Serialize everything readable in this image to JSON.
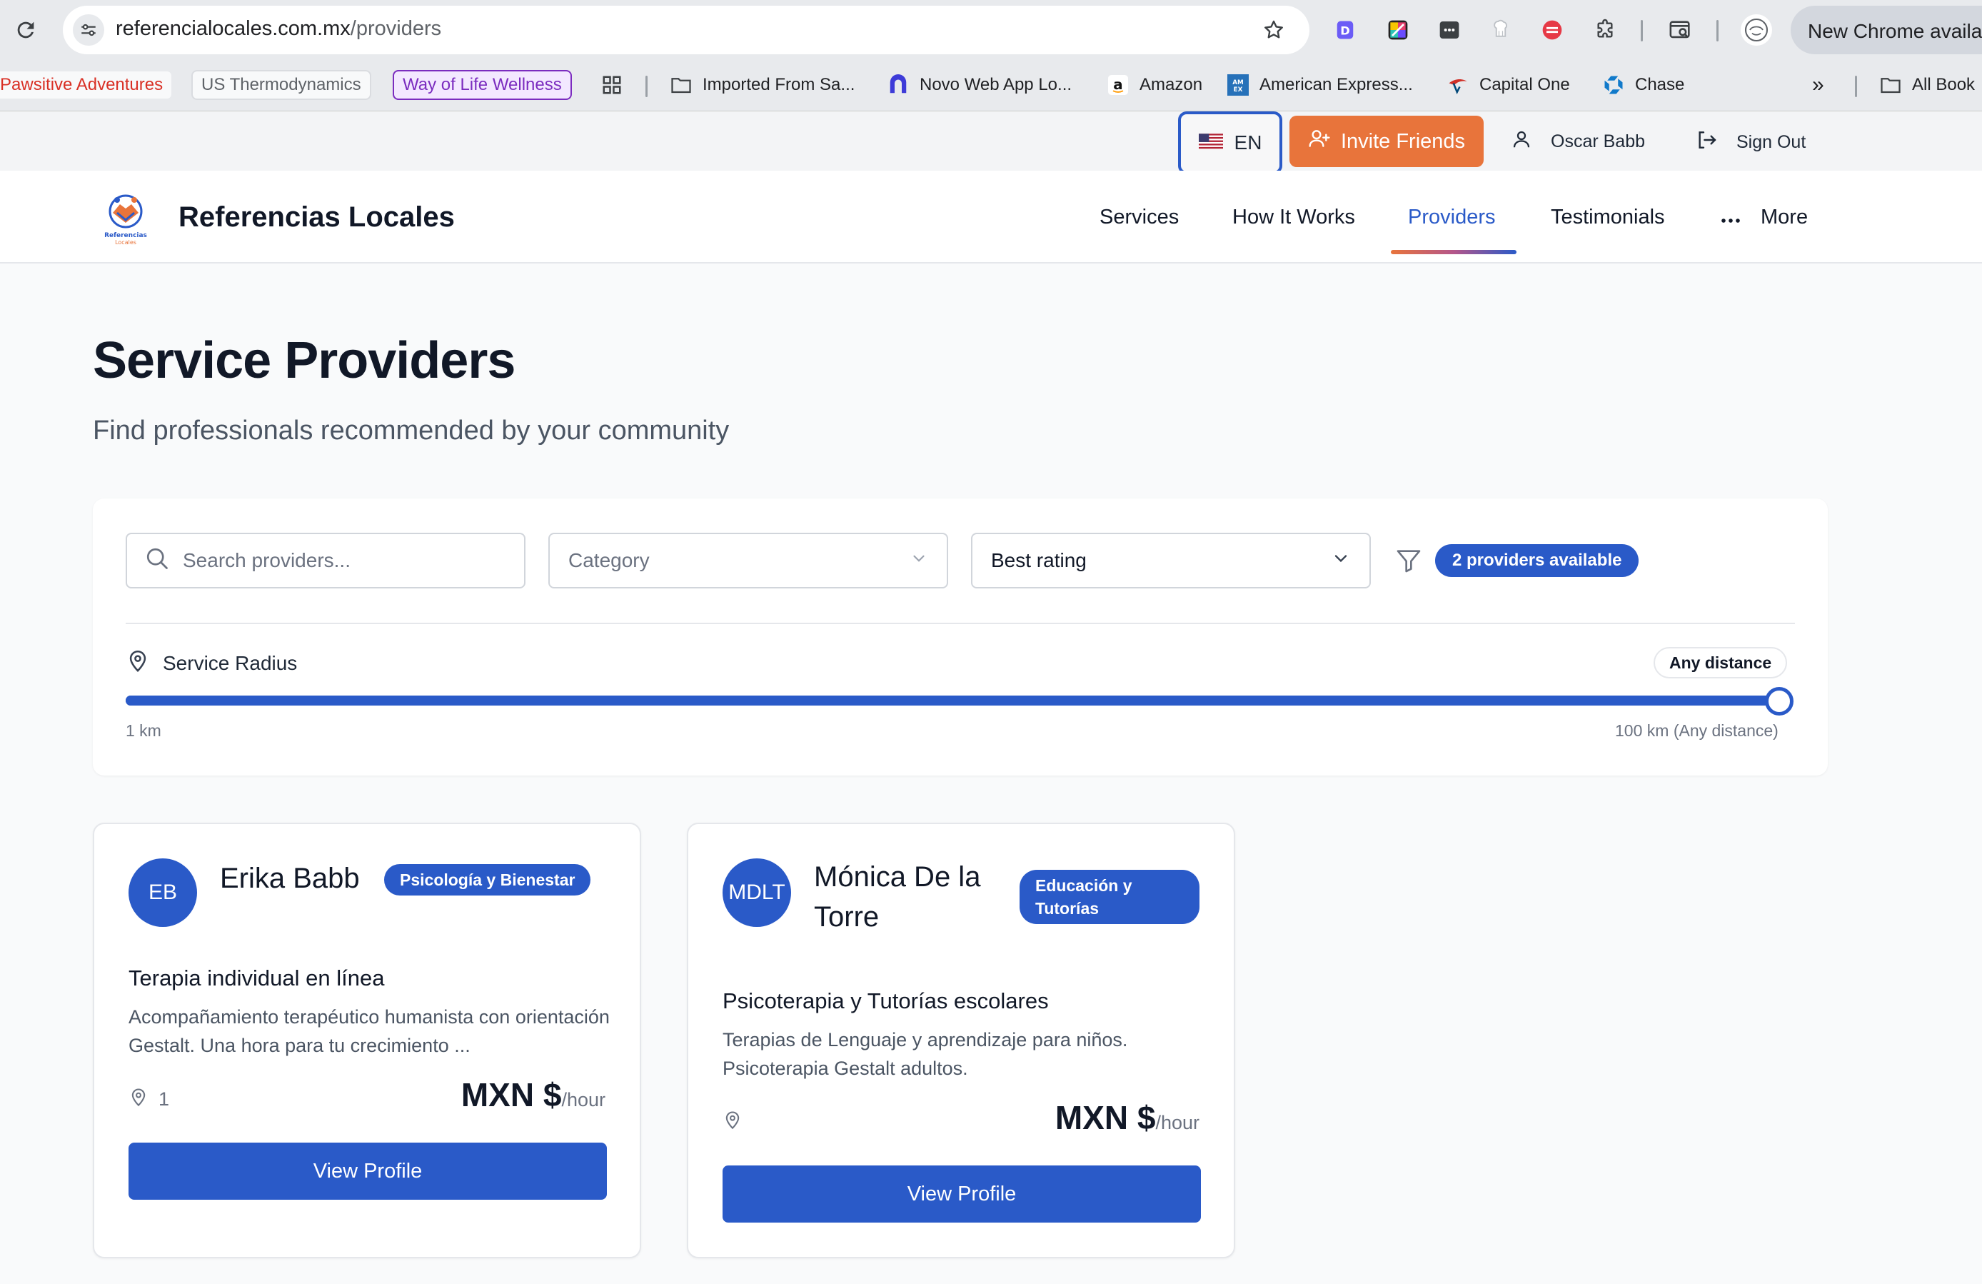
{
  "browser": {
    "url_host": "referencialocales.com.mx",
    "url_path": "/providers",
    "update_label": "New Chrome availab",
    "bookmarks": [
      {
        "label": "Pawsitive Adventures",
        "color": "#d93025"
      },
      {
        "label": "US Thermodynamics",
        "color": "#5f6368"
      },
      {
        "label": "Way of Life Wellness",
        "color": "#7b2cbf"
      },
      {
        "label": "Imported From Sa..."
      },
      {
        "label": "Novo Web App Lo..."
      },
      {
        "label": "Amazon"
      },
      {
        "label": "American Express..."
      },
      {
        "label": "Capital One"
      },
      {
        "label": "Chase"
      },
      {
        "label": "All Book"
      }
    ],
    "overflow_label": "»"
  },
  "topbar": {
    "lang": "EN",
    "invite": "Invite Friends",
    "user": "Oscar Babb",
    "sign_out": "Sign Out"
  },
  "nav": {
    "brand": "Referencias Locales",
    "logo_text_1": "Referencias",
    "logo_text_2": "Locales",
    "items": [
      "Services",
      "How It Works",
      "Providers",
      "Testimonials",
      "More"
    ],
    "active": "Providers"
  },
  "page": {
    "title": "Service Providers",
    "subtitle": "Find professionals recommended by your community"
  },
  "filters": {
    "search_placeholder": "Search providers...",
    "category_placeholder": "Category",
    "sort_value": "Best rating",
    "count_badge": "2 providers available",
    "radius_label": "Service Radius",
    "distance_badge": "Any distance",
    "slider_min": "1 km",
    "slider_max": "100 km (Any distance)",
    "slider_value_fraction": 1.0
  },
  "providers": [
    {
      "initials": "EB",
      "name": "Erika Babb",
      "category": "Psicología y Bienestar",
      "service": "Terapia individual en línea",
      "description": "Acompañamiento terapéutico humanista con orientación Gestalt. Una hora para tu crecimiento ...",
      "location": "1",
      "price": "MXN $",
      "price_unit": "/hour",
      "button": "View Profile"
    },
    {
      "initials": "MDLT",
      "name": "Mónica De la Torre",
      "category": "Educación y Tutorías",
      "service": "Psicoterapia y Tutorías escolares",
      "description": "Terapias de Lenguaje y aprendizaje para niños. Psicoterapia Gestalt adultos.",
      "location": "",
      "price": "MXN $",
      "price_unit": "/hour",
      "button": "View Profile"
    }
  ],
  "colors": {
    "primary": "#2a5ac8",
    "accent": "#e8743b"
  }
}
